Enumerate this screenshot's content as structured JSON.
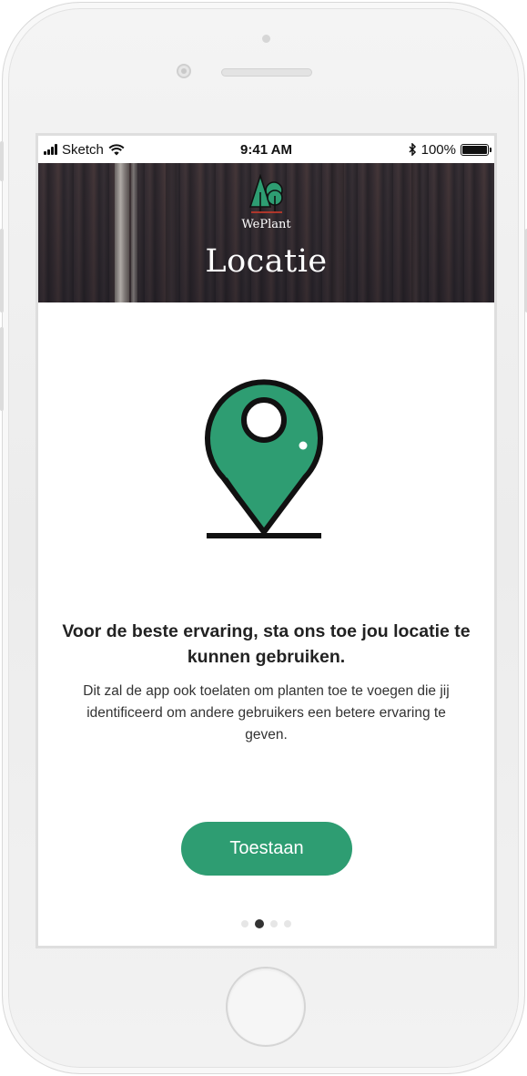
{
  "status_bar": {
    "carrier": "Sketch",
    "time": "9:41 AM",
    "battery_percent": "100%"
  },
  "header": {
    "brand": "WePlant",
    "title": "Locatie"
  },
  "content": {
    "headline": "Voor de beste ervaring, sta ons toe jou locatie te kunnen gebruiken.",
    "body": "Dit zal de app ook toelaten om planten toe te voegen die jij identificeerd om andere gebruikers een betere ervaring te geven."
  },
  "actions": {
    "allow_label": "Toestaan"
  },
  "pagination": {
    "total": 4,
    "current": 2
  },
  "colors": {
    "accent": "#2e9d72",
    "text_dark": "#222222"
  },
  "icons": [
    "signal-icon",
    "wifi-icon",
    "bluetooth-icon",
    "battery-icon",
    "weplant-logo-icon",
    "location-pin-icon"
  ]
}
